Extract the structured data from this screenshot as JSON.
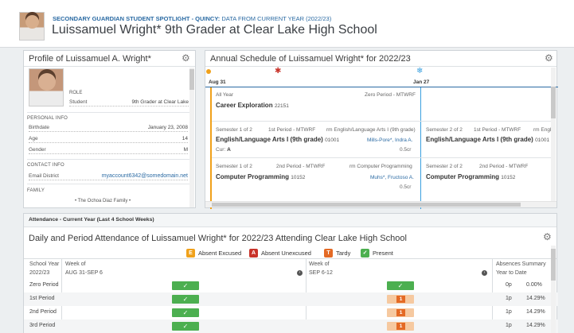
{
  "header": {
    "crumb_bold": "SECONDARY GUARDIAN STUDENT SPOTLIGHT - QUINCY:",
    "crumb_note": "DATA FROM CURRENT YEAR (2022/23)",
    "title": "Luissamuel Wright* 9th Grader at Clear Lake High School"
  },
  "profile": {
    "title": "Profile of Luissamuel A. Wright*",
    "role_label": "ROLE",
    "student_label": "Student",
    "student_value": "9th Grader at Clear Lake",
    "personal_info": "PERSONAL INFO",
    "birthdate_label": "Birthdate",
    "birthdate_value": "January 23, 2008",
    "age_label": "Age",
    "age_value": "14",
    "gender_label": "Gender",
    "gender_value": "M",
    "contact_info": "CONTACT INFO",
    "email_label": "Email District",
    "email_value": "myaccount6342@somedomain.net",
    "family": "FAMILY",
    "family_value": "• The Ochoa Diaz Family •"
  },
  "schedule": {
    "title": "Annual Schedule of Luissamuel Wright* for 2022/23",
    "aug": "Aug 31",
    "jan": "Jan 27",
    "all_year": "All Year",
    "zero_period": "Zero Period - MTWRF",
    "career_name": "Career Exploration",
    "career_num": "22151",
    "s1": "Semester 1 of 2",
    "p1": "1st Period - MTWRF",
    "rm_eng": "rm English/Language Arts I (9th grade)",
    "eng_name": "English/Language Arts I (9th grade)",
    "eng_num": "01001",
    "teacher_eng": "Mills-Pore*, Indra A.",
    "cur_label": "Cur:",
    "cur_grade": "A",
    "credits": "0.5cr",
    "s2": "Semester 2 of 2",
    "p1_cut": "1st Period - MTWRF",
    "rm_cut": "rm Engli",
    "p2": "2nd Period - MTWRF",
    "rm_cp": "rm Computer Programming",
    "cp_name": "Computer Programming",
    "cp_num": "10152",
    "teacher_cp": "Muhs*, Fructoso A.",
    "s2b": "Semester 2 of 2",
    "p2b": "2nd Period - MTWRF"
  },
  "attendance": {
    "strip": "Attendance - Current Year (Last 4 School Weeks)",
    "title": "Daily and Period Attendance of Luissamuel Wright* for 2022/23 Attending Clear Lake High School",
    "legend": [
      {
        "code": "E",
        "label": "Absent Excused",
        "color": "#f0a11b"
      },
      {
        "code": "A",
        "label": "Absent Unexcused",
        "color": "#c8332a"
      },
      {
        "code": "T",
        "label": "Tardy",
        "color": "#e46a25"
      },
      {
        "code": "✓",
        "label": "Present",
        "color": "#4caf50"
      }
    ],
    "school_year": "School Year",
    "year": "2022/23",
    "week_of": "Week of",
    "week1": "AUG 31-SEP 6",
    "week2": "SEP 6-12",
    "abs_summary": "Absences Summary",
    "ytd": "Year to Date",
    "rows": [
      {
        "label": "Zero Period",
        "w1": "present",
        "w2": "present",
        "count": "0p",
        "pct": "0.00%"
      },
      {
        "label": "1st Period",
        "w1": "present",
        "w2": "tardy",
        "count": "1p",
        "pct": "14.29%"
      },
      {
        "label": "2nd Period",
        "w1": "present",
        "w2": "tardy",
        "count": "1p",
        "pct": "14.29%"
      },
      {
        "label": "3rd Period",
        "w1": "present",
        "w2": "tardy",
        "count": "1p",
        "pct": "14.29%"
      }
    ]
  }
}
